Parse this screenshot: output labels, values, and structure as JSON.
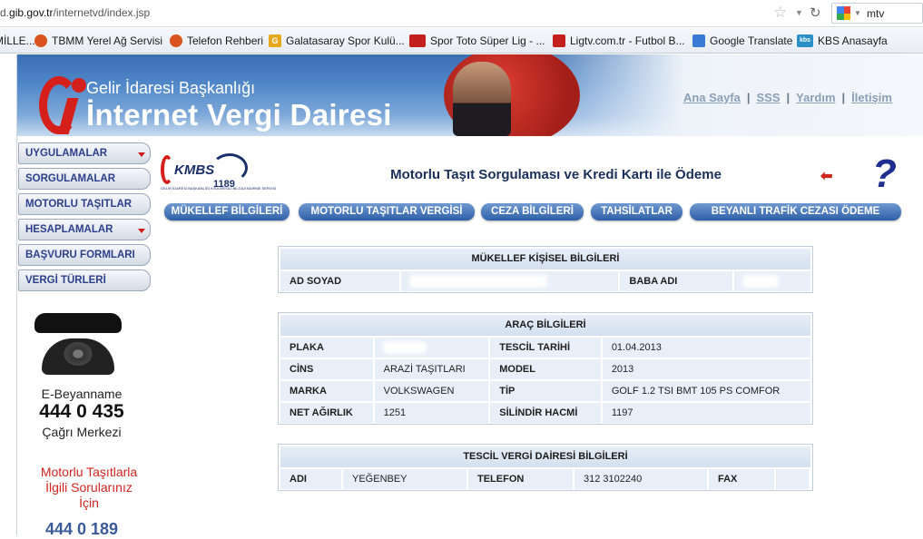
{
  "browser": {
    "url_prefix": "d.",
    "url_domain": "gib.gov.tr",
    "url_path": "/internetvd/index.jsp",
    "search_text": "mtv",
    "bookmarks": [
      {
        "label": "MİLLE...",
        "icon": "globe-icon",
        "color": "#3a7bd5"
      },
      {
        "label": "TBMM Yerel Ağ Servisi",
        "icon": "tbmm-icon",
        "color": "#d9541e"
      },
      {
        "label": "Telefon Rehberi",
        "icon": "tbmm-icon",
        "color": "#d9541e"
      },
      {
        "label": "Galatasaray Spor Kulü...",
        "icon": "galatasaray-icon",
        "color": "#e5a81c"
      },
      {
        "label": "Spor Toto Süper Lig - ...",
        "icon": "spor-toto-icon",
        "color": "#c41f1f"
      },
      {
        "label": "Ligtv.com.tr - Futbol B...",
        "icon": "ligtv-icon",
        "color": "#c41f1f"
      },
      {
        "label": "Google Translate",
        "icon": "google-translate-icon",
        "color": "#3a7bd5"
      },
      {
        "label": "KBS Anasayfa",
        "icon": "kbs-icon",
        "color": "#2a8fc7"
      }
    ]
  },
  "header": {
    "org": "Gelir İdaresi Başkanlığı",
    "title": "İnternet Vergi Dairesi",
    "links": [
      "Ana Sayfa",
      "SSS",
      "Yardım",
      "İletişim"
    ]
  },
  "sidebar": {
    "items": [
      {
        "label": "UYGULAMALAR",
        "has_dropdown": true
      },
      {
        "label": "SORGULAMALAR",
        "has_dropdown": false
      },
      {
        "label": "MOTORLU TAŞITLAR",
        "has_dropdown": false
      },
      {
        "label": "HESAPLAMALAR",
        "has_dropdown": true
      },
      {
        "label": "BAŞVURU FORMLARI",
        "has_dropdown": false
      },
      {
        "label": "VERGİ TÜRLERİ",
        "has_dropdown": false
      }
    ],
    "ad": {
      "ebeyanname": "E-Beyanname",
      "number": "444 0 435",
      "cagri": "Çağrı Merkezi",
      "mtv_line1": "Motorlu Taşıtlarla",
      "mtv_line2": "İlgili Sorularınız",
      "mtv_line3": "İçin",
      "mtv_number": "444 0 189"
    }
  },
  "content": {
    "logo_text": "KMBS",
    "logo_number": "1189",
    "logo_subtext": "GELİR İDARESİ BAŞKANLIĞI KISA MESAJ BİLGİLENDİRME SERVİSİ",
    "title": "Motorlu Taşıt Sorgulaması ve Kredi Kartı ile Ödeme",
    "back_icon": "back-arrow-icon",
    "help_icon": "help-question-icon",
    "tabs": [
      "MÜKELLEF BİLGİLERİ",
      "MOTORLU TAŞITLAR VERGİSİ",
      "CEZA BİLGİLERİ",
      "TAHSİLATLAR",
      "BEYANLI TRAFİK CEZASI ÖDEME"
    ]
  },
  "mukellef": {
    "heading": "MÜKELLEF KİŞİSEL BİLGİLERİ",
    "ad_soyad_label": "AD SOYAD",
    "baba_adi_label": "BABA ADI"
  },
  "arac": {
    "heading": "ARAÇ BİLGİLERİ",
    "plaka_label": "PLAKA",
    "tescil_tarihi_label": "TESCİL TARİHİ",
    "tescil_tarihi": "01.04.2013",
    "cins_label": "CİNS",
    "cins": "ARAZİ TAŞITLARI",
    "model_label": "MODEL",
    "model": "2013",
    "marka_label": "MARKA",
    "marka": "VOLKSWAGEN",
    "tip_label": "TİP",
    "tip": "GOLF 1.2 TSI BMT 105 PS COMFOR",
    "net_agirlik_label": "NET AĞIRLIK",
    "net_agirlik": "1251",
    "silindir_label": "SİLİNDİR HACMİ",
    "silindir": "1197"
  },
  "tescil": {
    "heading": "TESCİL VERGİ DAİRESİ BİLGİLERİ",
    "adi_label": "ADI",
    "adi": "YEĞENBEY",
    "telefon_label": "TELEFON",
    "telefon": "312 3102240",
    "fax_label": "FAX",
    "fax": ""
  }
}
